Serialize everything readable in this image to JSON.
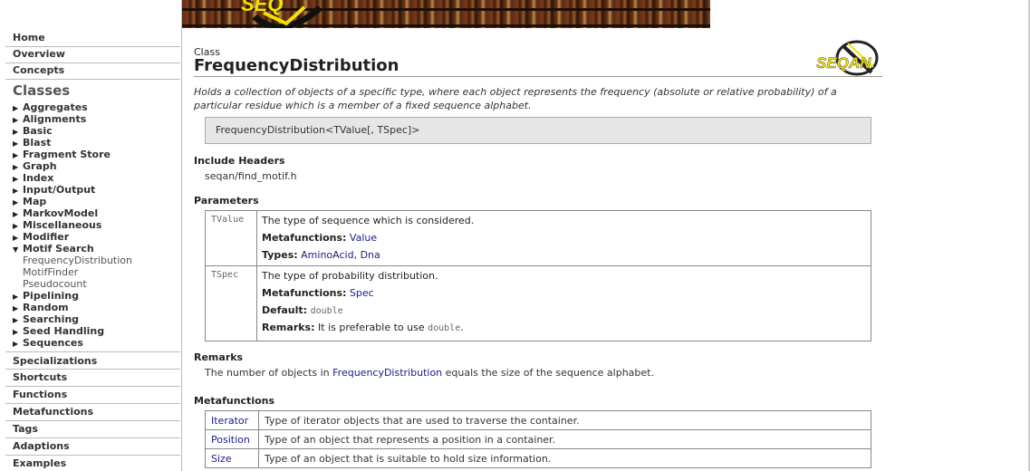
{
  "sidebar": {
    "top_links": [
      "Home",
      "Overview",
      "Concepts"
    ],
    "classes_title": "Classes",
    "categories_before": [
      "Aggregates",
      "Alignments",
      "Basic",
      "Blast",
      "Fragment Store",
      "Graph",
      "Index",
      "Input/Output",
      "Map",
      "MarkovModel",
      "Miscellaneous",
      "Modifier"
    ],
    "open_category": "Motif Search",
    "open_items": [
      "FrequencyDistribution",
      "MotifFinder",
      "Pseudocount"
    ],
    "categories_after": [
      "Pipelining",
      "Random",
      "Searching",
      "Seed Handling",
      "Sequences"
    ],
    "bottom_links": [
      "Specializations",
      "Shortcuts",
      "Functions",
      "Metafunctions",
      "Tags",
      "Adaptions",
      "Examples"
    ]
  },
  "logo": {
    "text": "SEQAN",
    "top_text": "SEQ"
  },
  "page": {
    "kind": "Class",
    "title": "FrequencyDistribution",
    "brief_line1": "Holds a collection of objects of a specific type, where each object represents the frequency (absolute or relative probability) of a",
    "brief_line2": "particular residue which is a member of a fixed sequence alphabet.",
    "signature": "FrequencyDistribution<TValue[, TSpec]>"
  },
  "include": {
    "heading": "Include Headers",
    "file": "seqan/find_motif.h"
  },
  "parameters": {
    "heading": "Parameters",
    "tvalue": {
      "name": "TValue",
      "desc": "The type of sequence which is considered.",
      "mf_label": "Metafunctions:",
      "mf_link": "Value",
      "types_label": "Types:",
      "type1": "AminoAcid",
      "sep": ", ",
      "type2": "Dna"
    },
    "tspec": {
      "name": "TSpec",
      "desc": "The type of probability distribution.",
      "mf_label": "Metafunctions:",
      "mf_link": "Spec",
      "default_label": "Default:",
      "default_value": "double",
      "remarks_label": "Remarks:",
      "remarks_text": "It is preferable to use",
      "remarks_code": "double",
      "remarks_end": "."
    }
  },
  "remarks": {
    "heading": "Remarks",
    "pre": "The number of objects in",
    "link": "FrequencyDistribution",
    "post": "equals the size of the sequence alphabet."
  },
  "metafunctions": {
    "heading": "Metafunctions",
    "rows": [
      {
        "name": "Iterator",
        "desc": "Type of iterator objects that are used to traverse the container."
      },
      {
        "name": "Position",
        "desc": "Type of an object that represents a position in a container."
      },
      {
        "name": "Size",
        "desc": "Type of an object that is suitable to hold size information."
      }
    ]
  }
}
